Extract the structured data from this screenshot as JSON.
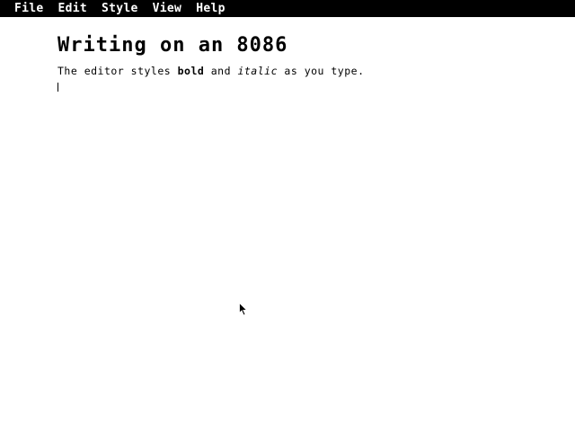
{
  "menubar": {
    "items": [
      "File",
      "Edit",
      "Style",
      "View",
      "Help"
    ]
  },
  "document": {
    "title": "Writing on an 8086",
    "paragraph": {
      "part1": "The editor styles ",
      "bold": "bold",
      "part2": " and ",
      "italic": "italic",
      "part3": " as you type."
    }
  },
  "colors": {
    "menubar_bg": "#000000",
    "menubar_text": "#ffffff",
    "page_bg": "#ffffff",
    "text": "#000000"
  },
  "icons": {
    "pointer": "arrow-pointer-icon",
    "caret": "text-caret"
  }
}
